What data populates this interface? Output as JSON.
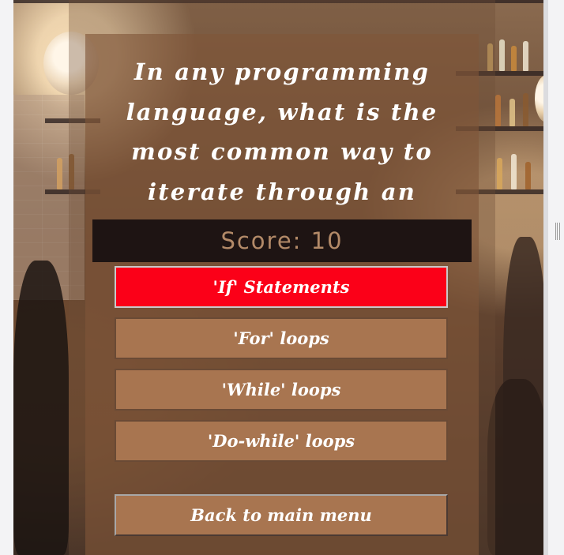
{
  "quiz": {
    "question": "In any programming language, what is the most common way to iterate through an array?",
    "score_text": "Score: 10",
    "answers": [
      {
        "label": "'If' Statements",
        "state": "incorrect-selected"
      },
      {
        "label": "'For' loops",
        "state": "default"
      },
      {
        "label": "'While' loops",
        "state": "default"
      },
      {
        "label": "'Do-while' loops",
        "state": "default"
      }
    ],
    "back_label": "Back to main menu"
  },
  "colors": {
    "wrong_answer": "#fb0018",
    "answer_bg": "#a87550",
    "score_bg": "#1e1413",
    "score_text": "#b38a68"
  }
}
